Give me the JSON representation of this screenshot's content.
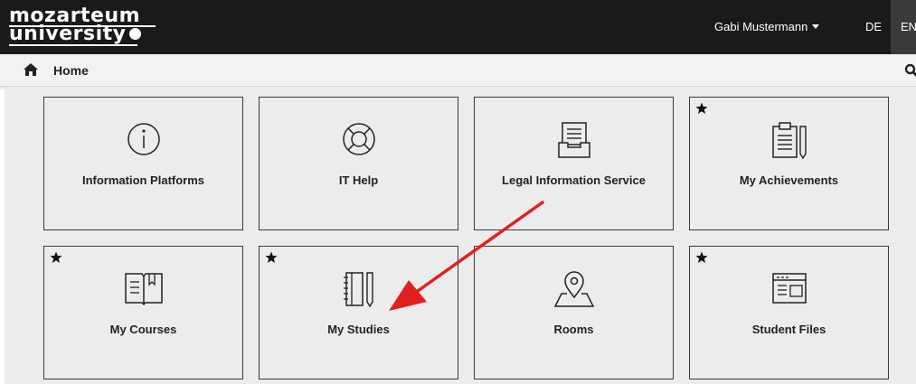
{
  "header": {
    "logo_line1": "mozarteum",
    "logo_line2": "university",
    "user_name": "Gabi Mustermann",
    "lang_de": "DE",
    "lang_en": "EN"
  },
  "breadcrumb": {
    "home_label": "Home"
  },
  "tiles": [
    {
      "label": "Information Platforms",
      "icon": "info-icon",
      "favorite": false
    },
    {
      "label": "IT Help",
      "icon": "lifebuoy-icon",
      "favorite": false
    },
    {
      "label": "Legal Information Service",
      "icon": "inbox-tray-icon",
      "favorite": false
    },
    {
      "label": "My Achievements",
      "icon": "clipboard-pencil-icon",
      "favorite": true
    },
    {
      "label": "My Courses",
      "icon": "open-book-icon",
      "favorite": true
    },
    {
      "label": "My Studies",
      "icon": "notebook-pencil-icon",
      "favorite": true
    },
    {
      "label": "Rooms",
      "icon": "map-pin-icon",
      "favorite": false
    },
    {
      "label": "Student Files",
      "icon": "browser-window-icon",
      "favorite": true
    }
  ],
  "colors": {
    "topbar": "#1a1a1a",
    "tile_bg": "#ececec",
    "annotation_arrow": "#e02020"
  }
}
